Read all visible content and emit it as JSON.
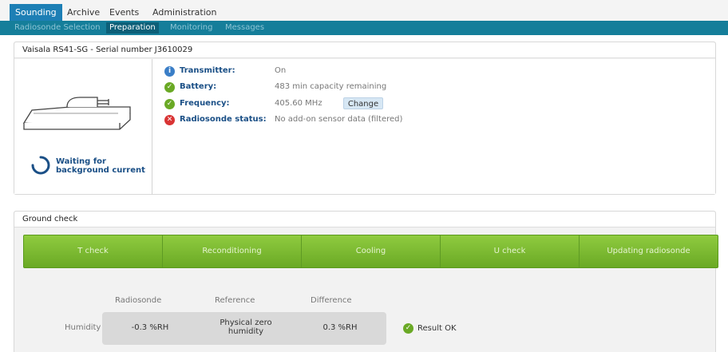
{
  "top_tabs": [
    {
      "label": "Sounding"
    },
    {
      "label": "Archive"
    },
    {
      "label": "Events"
    },
    {
      "label": "Administration"
    }
  ],
  "sub_tabs": [
    {
      "label": "Radiosonde Selection"
    },
    {
      "label": "Preparation"
    },
    {
      "label": "Monitoring"
    },
    {
      "label": "Messages"
    }
  ],
  "device": {
    "title": "Vaisala RS41-SG - Serial number J3610029",
    "waiting_line1": "Waiting for",
    "waiting_line2": "background current"
  },
  "status": [
    {
      "icon": "info-icon",
      "color": "#3a7ec7",
      "label": "Transmitter:",
      "value": "On"
    },
    {
      "icon": "check-icon",
      "color": "#6aa925",
      "label": "Battery:",
      "value": "483 min capacity remaining"
    },
    {
      "icon": "check-icon",
      "color": "#6aa925",
      "label": "Frequency:",
      "value": "405.60 MHz"
    },
    {
      "icon": "error-icon",
      "color": "#d93434",
      "label": "Radiosonde status:",
      "value": "No add-on sensor data (filtered)"
    }
  ],
  "change_button": "Change",
  "ground_check": {
    "title": "Ground check",
    "steps": [
      "T check",
      "Reconditioning",
      "Cooling",
      "U check",
      "Updating radiosonde"
    ],
    "columns": [
      "Radiosonde",
      "Reference",
      "Difference"
    ],
    "row_label": "Humidity",
    "radiosonde_value": "-0.3 %RH",
    "reference_line1": "Physical zero",
    "reference_line2": "humidity",
    "difference_value": "0.3 %RH",
    "result": "Result OK"
  },
  "colors": {
    "accent": "#1d7fb5",
    "subnav": "#157e9a",
    "step_green": "#7cba32",
    "ok_green": "#6aa925",
    "error_red": "#d93434",
    "info_blue": "#3a7ec7"
  }
}
